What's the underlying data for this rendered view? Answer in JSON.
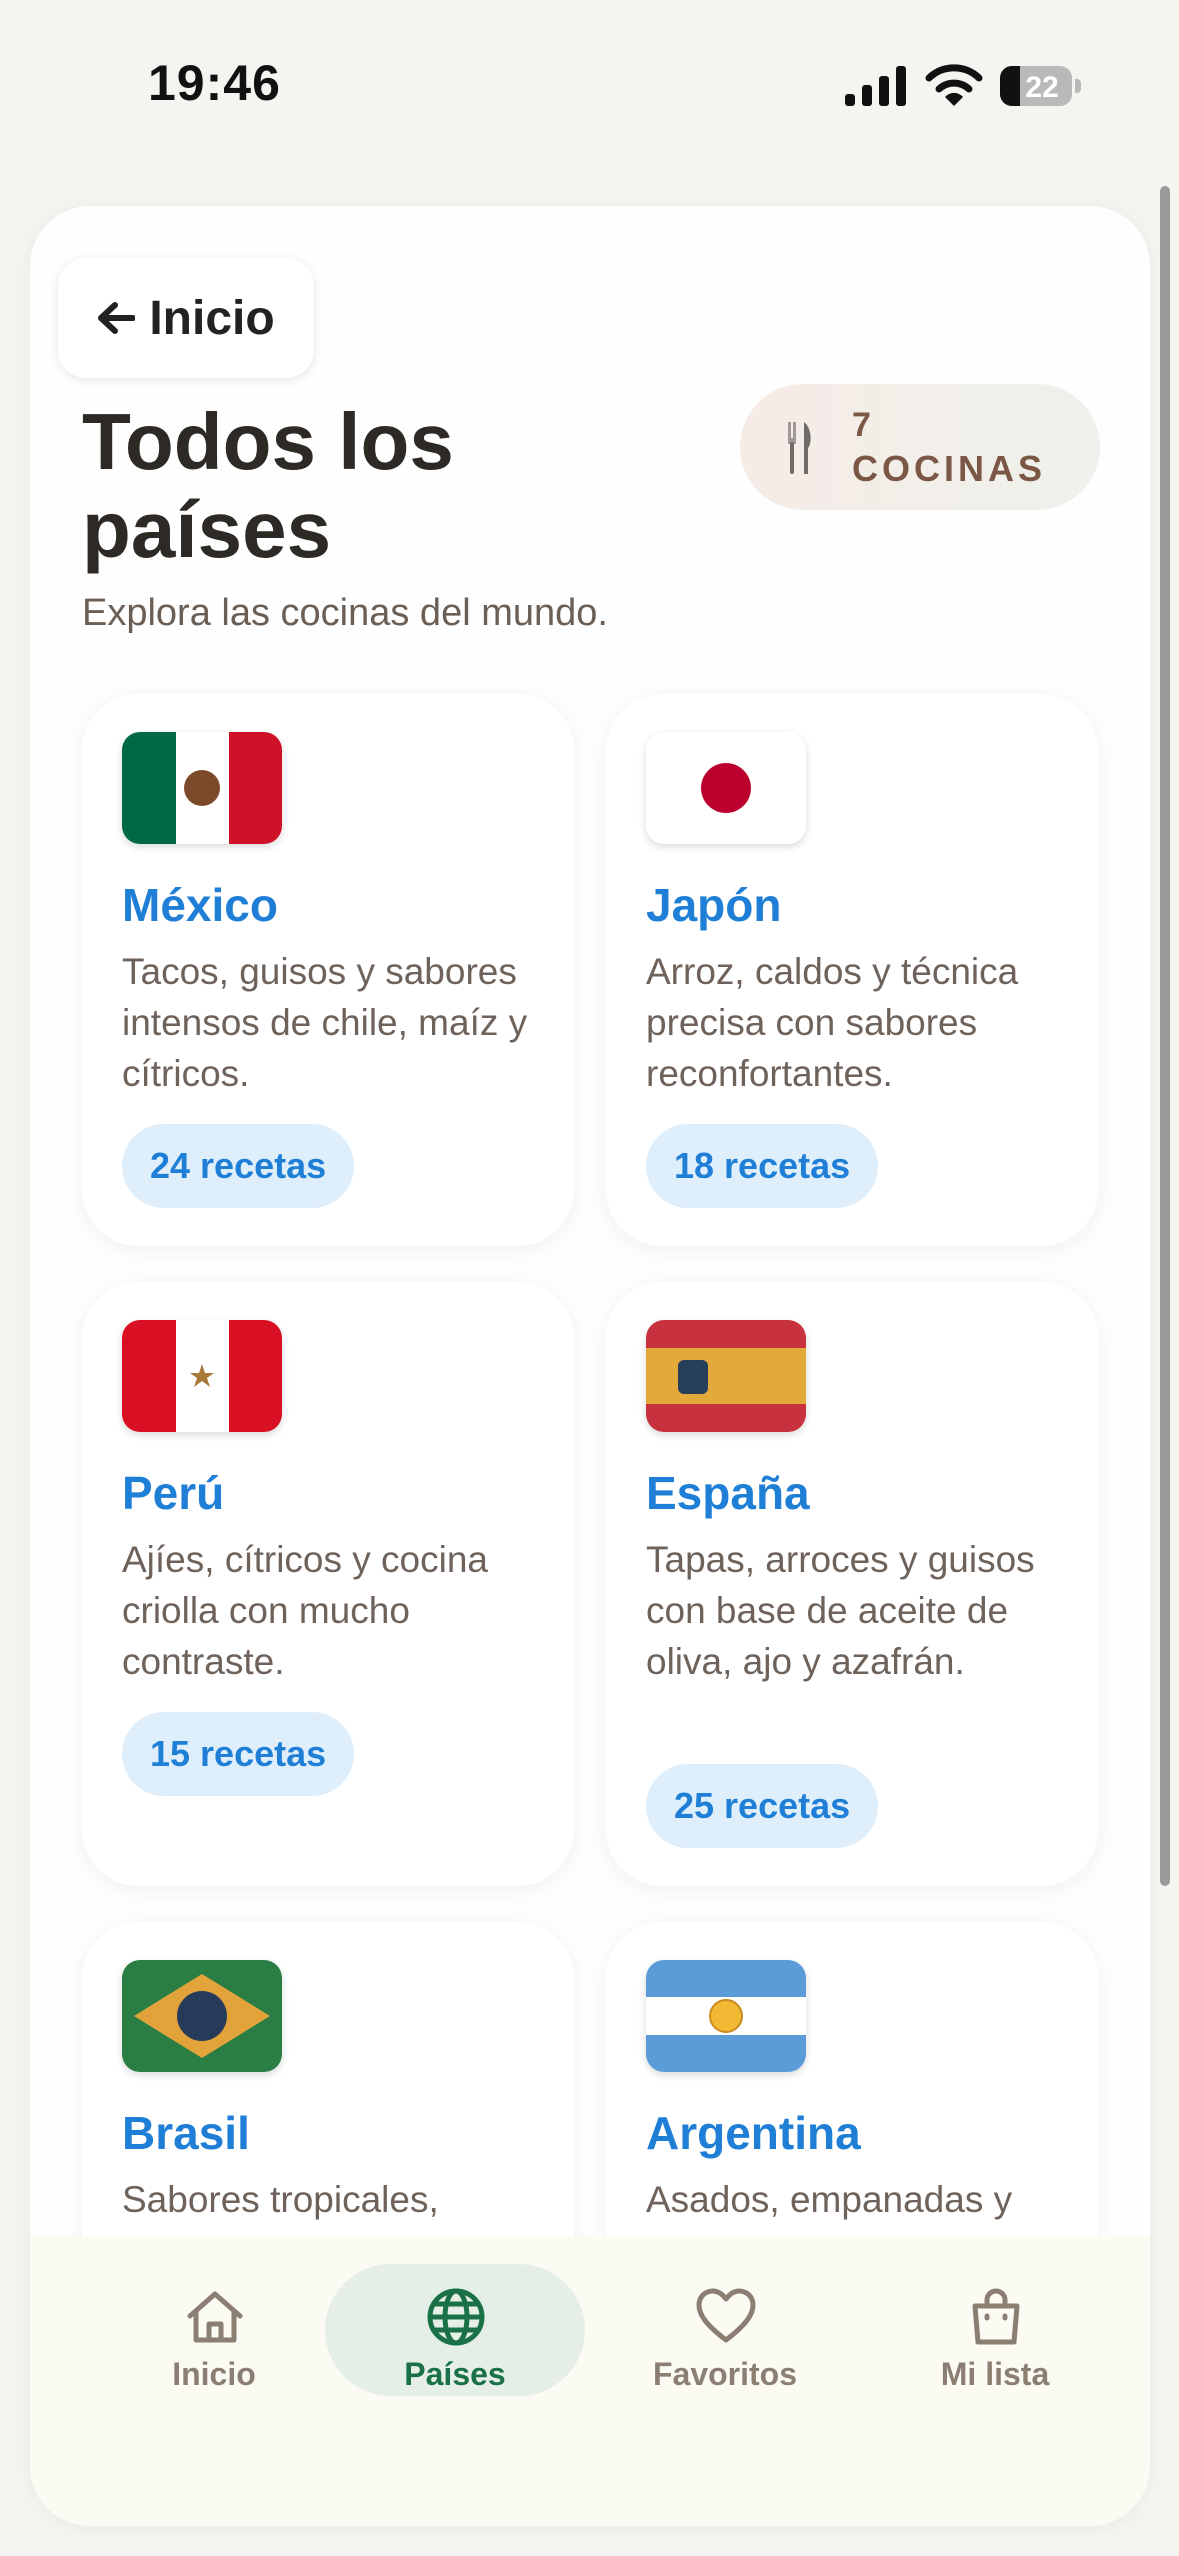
{
  "status_bar": {
    "time": "19:46",
    "battery": "22"
  },
  "header": {
    "back_label": "Inicio",
    "title": "Todos los países",
    "subtitle": "Explora las cocinas del mundo.",
    "count_number": "7",
    "count_word": "COCINAS"
  },
  "countries": [
    {
      "name": "México",
      "description": "Tacos, guisos y sabores intensos de chile, maíz y cítricos.",
      "recipes": "24 recetas"
    },
    {
      "name": "Japón",
      "description": "Arroz, caldos y técnica precisa con sabores reconfortantes.",
      "recipes": "18 recetas"
    },
    {
      "name": "Perú",
      "description": "Ajíes, cítricos y cocina criolla con mucho contraste.",
      "recipes": "15 recetas"
    },
    {
      "name": "España",
      "description": "Tapas, arroces y guisos con base de aceite de oliva, ajo y azafrán.",
      "recipes": "25 recetas"
    },
    {
      "name": "Brasil",
      "description": "Sabores tropicales,",
      "recipes": ""
    },
    {
      "name": "Argentina",
      "description": "Asados, empanadas y",
      "recipes": ""
    }
  ],
  "tab_bar": {
    "items": [
      {
        "label": "Inicio",
        "icon": "home-icon"
      },
      {
        "label": "Países",
        "icon": "globe-icon",
        "active": true
      },
      {
        "label": "Favoritos",
        "icon": "heart-icon"
      },
      {
        "label": "Mi lista",
        "icon": "shopping-bag-icon"
      }
    ]
  },
  "colors": {
    "accent_blue": "#1f7fd6",
    "active_green": "#1a7148",
    "title_brown": "#2d2a26"
  }
}
